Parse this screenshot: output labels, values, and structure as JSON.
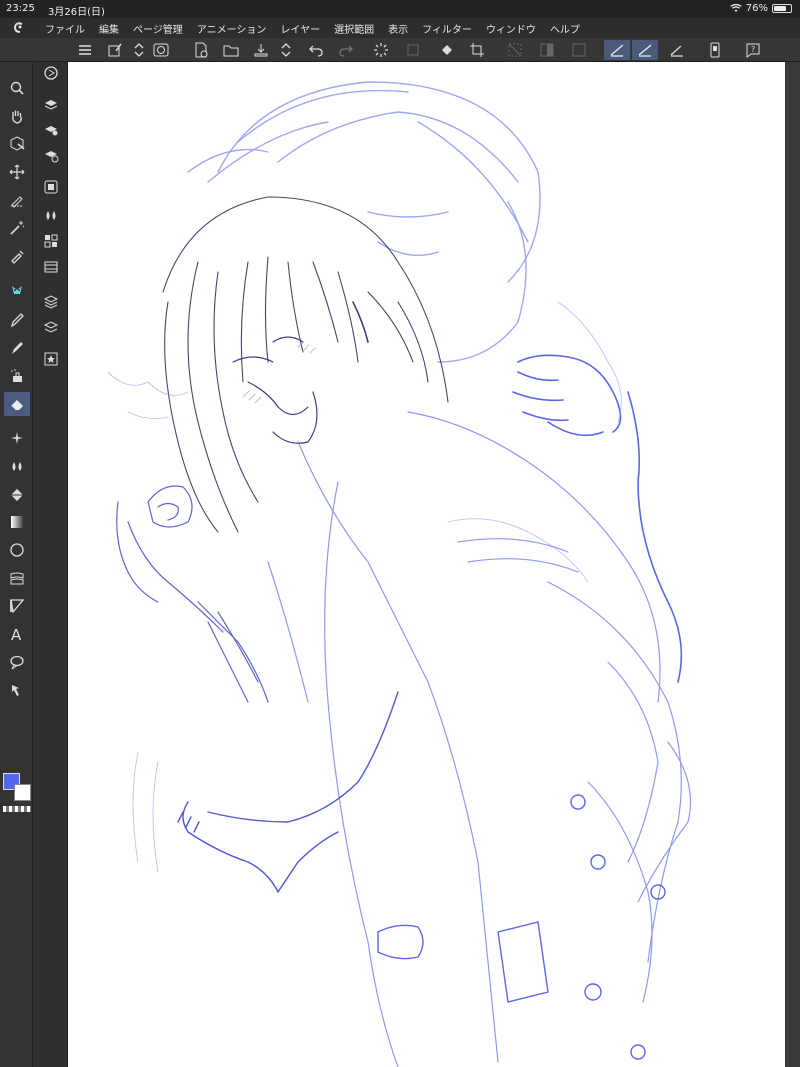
{
  "status": {
    "time": "23:25",
    "date": "3月26日(日)",
    "battery_text": "76%",
    "battery_level": 0.76
  },
  "menu": {
    "items": [
      "ファイル",
      "編集",
      "ページ管理",
      "アニメーション",
      "レイヤー",
      "選択範囲",
      "表示",
      "フィルター",
      "ウィンドウ",
      "ヘルプ"
    ]
  },
  "panels": {
    "collapse_left": "«",
    "collapse_right": "«"
  },
  "colors": {
    "main": "#5566f0",
    "sub": "#ffffff",
    "accent": "#4c5c80",
    "sketch_blue": "#5a68e8",
    "sketch_dark": "#2a2f5a"
  },
  "toolbar_icons": [
    "zoom-icon",
    "hand-icon",
    "operation-icon",
    "move-icon",
    "lasso-fill-icon",
    "magic-wand-icon",
    "eyedropper-icon",
    "pen-icon",
    "pencil-icon",
    "brush-icon",
    "airbrush-icon",
    "eraser-icon",
    "decoration-icon",
    "blend-icon",
    "fill-icon",
    "gradient-icon",
    "figure-icon",
    "frame-icon",
    "ruler-icon",
    "text-icon",
    "balloon-icon",
    "correct-line-icon"
  ],
  "active_tool": "eraser-icon"
}
